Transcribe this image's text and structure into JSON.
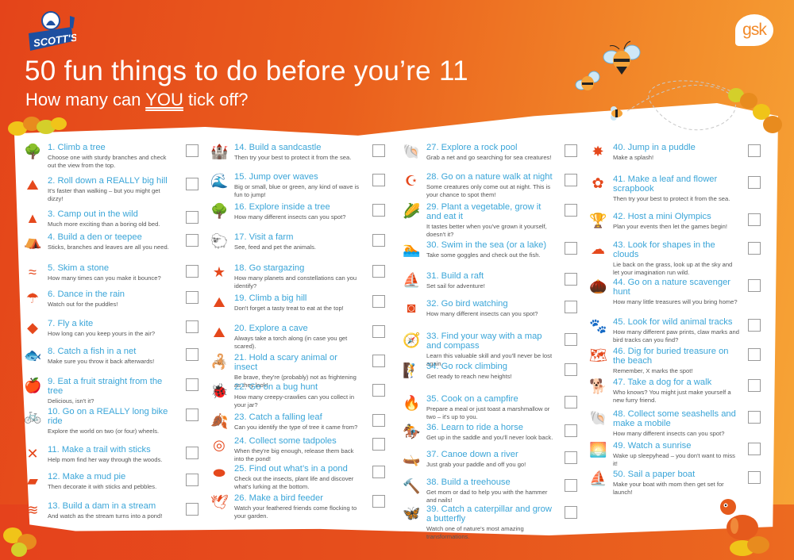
{
  "header": {
    "brand_left": "SCOTT'S",
    "brand_right": "gsk",
    "title": "50 fun things to do before you’re 11",
    "subtitle_pre": "How many can ",
    "subtitle_emph": "YOU",
    "subtitle_post": " tick off?"
  },
  "colors": {
    "background_orange": "#e95a1c",
    "accent_orange": "#e5481c",
    "item_title_blue": "#3aa5d8",
    "description_gray": "#555555",
    "checkbox_border": "#9a9a9a"
  },
  "columns": [
    {
      "items": [
        {
          "num": "1.",
          "title": "Climb a tree",
          "desc": "Choose one with sturdy branches and check out the view from the top.",
          "icon": "tree-climber-icon",
          "glyph": "🌳",
          "checked": false
        },
        {
          "num": "2.",
          "title": "Roll down a REALLY big hill",
          "desc": "It's faster than walking – but you might get dizzy!",
          "icon": "hill-roll-icon",
          "glyph": "⛰",
          "checked": false
        },
        {
          "num": "3.",
          "title": "Camp out in the wild",
          "desc": "Much more exciting than a boring old bed.",
          "icon": "tent-icon",
          "glyph": "▲",
          "checked": false
        },
        {
          "num": "4.",
          "title": "Build a den or teepee",
          "desc": "Sticks, branches and leaves are all you need.",
          "icon": "teepee-icon",
          "glyph": "⛺",
          "checked": false
        },
        {
          "num": "5.",
          "title": "Skim a stone",
          "desc": "How many times can you make it bounce?",
          "icon": "stone-skim-icon",
          "glyph": "≈",
          "checked": false
        },
        {
          "num": "6.",
          "title": "Dance in the rain",
          "desc": "Watch out for the puddles!",
          "icon": "rain-boot-icon",
          "glyph": "☂",
          "checked": false
        },
        {
          "num": "7.",
          "title": "Fly a kite",
          "desc": "How long can you keep yours in the air?",
          "icon": "kite-icon",
          "glyph": "◆",
          "checked": false
        },
        {
          "num": "8.",
          "title": "Catch a fish in a net",
          "desc": "Make sure you throw it back afterwards!",
          "icon": "fish-icon",
          "glyph": "🐟",
          "checked": false
        },
        {
          "num": "9.",
          "title": "Eat a fruit straight from the tree",
          "desc": "Delicious, isn't it?",
          "icon": "apple-icon",
          "glyph": "🍎",
          "checked": false
        },
        {
          "num": "10.",
          "title": "Go on a REALLY long bike ride",
          "desc": "Explore the world on two (or four) wheels.",
          "icon": "bicycle-icon",
          "glyph": "🚲",
          "checked": false
        },
        {
          "num": "11.",
          "title": "Make a trail with sticks",
          "desc": "Help mom find her way through the woods.",
          "icon": "crossed-sticks-icon",
          "glyph": "✕",
          "checked": false
        },
        {
          "num": "12.",
          "title": "Make a mud pie",
          "desc": "Then decorate it with sticks and pebbles.",
          "icon": "mud-pie-icon",
          "glyph": "▰",
          "checked": false
        },
        {
          "num": "13.",
          "title": "Build a dam in a stream",
          "desc": "And watch as the stream turns into a pond!",
          "icon": "dam-icon",
          "glyph": "≋",
          "checked": false
        }
      ]
    },
    {
      "items": [
        {
          "num": "14.",
          "title": "Build a sandcastle",
          "desc": "Then try your best to protect it from the sea.",
          "icon": "sandcastle-icon",
          "glyph": "🏰",
          "checked": false
        },
        {
          "num": "15.",
          "title": "Jump over waves",
          "desc": "Big or small, blue or green, any kind of wave is fun to jump!",
          "icon": "wave-icon",
          "glyph": "🌊",
          "checked": false
        },
        {
          "num": "16.",
          "title": "Explore inside a tree",
          "desc": "How many different insects can you spot?",
          "icon": "tree-icon",
          "glyph": "🌳",
          "checked": false
        },
        {
          "num": "17.",
          "title": "Visit a farm",
          "desc": "See, feed and pet the animals.",
          "icon": "sheep-icon",
          "glyph": "🐑",
          "checked": false
        },
        {
          "num": "18.",
          "title": "Go stargazing",
          "desc": "How many planets and constellations can you identify?",
          "icon": "stars-icon",
          "glyph": "★",
          "checked": false
        },
        {
          "num": "19.",
          "title": "Climb a big hill",
          "desc": "Don't forget a tasty treat to eat at the top!",
          "icon": "hill-icon",
          "glyph": "⛰",
          "checked": false
        },
        {
          "num": "20.",
          "title": "Explore a cave",
          "desc": "Always take a torch along (in case you get scared).",
          "icon": "cave-icon",
          "glyph": "⛰",
          "checked": false
        },
        {
          "num": "21.",
          "title": "Hold a scary animal or insect",
          "desc": "Be brave, they're (probably) not as frightening as they look!",
          "icon": "scorpion-icon",
          "glyph": "🦂",
          "checked": false
        },
        {
          "num": "22.",
          "title": "Go on a bug hunt",
          "desc": "How many creepy-crawlies can you collect in your jar?",
          "icon": "bug-icon",
          "glyph": "🐞",
          "checked": false
        },
        {
          "num": "23.",
          "title": "Catch a falling leaf",
          "desc": "Can you identify the type of tree it came from?",
          "icon": "hand-leaf-icon",
          "glyph": "🍂",
          "checked": false
        },
        {
          "num": "24.",
          "title": "Collect some tadpoles",
          "desc": "When they're big enough, release them back into the pond!",
          "icon": "tadpole-collector-icon",
          "glyph": "◎",
          "checked": false
        },
        {
          "num": "25.",
          "title": "Find out what’s in a pond",
          "desc": "Check out the insects, plant life and discover what's lurking at the bottom.",
          "icon": "pond-icon",
          "glyph": "⬬",
          "checked": false
        },
        {
          "num": "26.",
          "title": "Make a bird feeder",
          "desc": "Watch your feathered friends come flocking to your garden.",
          "icon": "bird-icon",
          "glyph": "🕊",
          "checked": false
        }
      ]
    },
    {
      "items": [
        {
          "num": "27.",
          "title": "Explore a rock pool",
          "desc": "Grab a net and go searching for sea creatures!",
          "icon": "seahorse-icon",
          "glyph": "🐚",
          "checked": false
        },
        {
          "num": "28.",
          "title": "Go on a nature walk at night",
          "desc": "Some creatures only come out at night. This is your chance to spot them!",
          "icon": "moon-star-icon",
          "glyph": "☪",
          "checked": false
        },
        {
          "num": "29.",
          "title": "Plant a vegetable, grow it and eat it",
          "desc": "It tastes better when you've grown it yourself, doesn't it?",
          "icon": "corn-icon",
          "glyph": "🌽",
          "checked": false
        },
        {
          "num": "30.",
          "title": "Swim in the sea (or a lake)",
          "desc": "Take some goggles and check out the fish.",
          "icon": "swimmer-icon",
          "glyph": "🏊",
          "checked": false
        },
        {
          "num": "31.",
          "title": "Build a raft",
          "desc": "Set sail for adventure!",
          "icon": "raft-icon",
          "glyph": "⛵",
          "checked": false
        },
        {
          "num": "32.",
          "title": "Go bird watching",
          "desc": "How many different insects can you spot?",
          "icon": "binoculars-icon",
          "glyph": "◙",
          "checked": false
        },
        {
          "num": "33.",
          "title": "Find your way with a map and compass",
          "desc": "Learn this valuable skill and you'll never be lost again.",
          "icon": "compass-icon",
          "glyph": "🧭",
          "checked": false
        },
        {
          "num": "34.",
          "title": "Go rock climbing",
          "desc": "Get ready to reach new heights!",
          "icon": "climber-icon",
          "glyph": "🧗",
          "checked": false
        },
        {
          "num": "35.",
          "title": "Cook on a campfire",
          "desc": "Prepare a meal or just toast a marshmallow or two – it's up to you.",
          "icon": "campfire-pan-icon",
          "glyph": "🔥",
          "checked": false
        },
        {
          "num": "36.",
          "title": "Learn to ride a horse",
          "desc": "Get up in the saddle and you'll never look back.",
          "icon": "horse-rider-icon",
          "glyph": "🏇",
          "checked": false
        },
        {
          "num": "37.",
          "title": "Canoe down a river",
          "desc": "Just grab your paddle and off you go!",
          "icon": "canoe-icon",
          "glyph": "🛶",
          "checked": false
        },
        {
          "num": "38.",
          "title": "Build a treehouse",
          "desc": "Get mom or dad to help you with the hammer and nails!",
          "icon": "hammer-icon",
          "glyph": "🔨",
          "checked": false
        },
        {
          "num": "39.",
          "title": "Catch a caterpillar and grow a butterfly",
          "desc": "Watch one of nature's most amazing transformations.",
          "icon": "butterfly-icon",
          "glyph": "🦋",
          "checked": false
        }
      ]
    },
    {
      "items": [
        {
          "num": "40.",
          "title": "Jump in a puddle",
          "desc": "Make a splash!",
          "icon": "splash-icon",
          "glyph": "✸",
          "checked": false
        },
        {
          "num": "41.",
          "title": "Make a leaf and flower scrapbook",
          "desc": "Then try your best to protect it from the sea.",
          "icon": "flower-icon",
          "glyph": "✿",
          "checked": false
        },
        {
          "num": "42.",
          "title": "Host a mini Olympics",
          "desc": "Plan your events then let the games begin!",
          "icon": "podium-icon",
          "glyph": "🏆",
          "checked": false
        },
        {
          "num": "43.",
          "title": "Look for shapes in the clouds",
          "desc": "Lie back on the grass, look up at the sky and let your imagination run wild.",
          "icon": "clouds-icon",
          "glyph": "☁",
          "checked": false
        },
        {
          "num": "44.",
          "title": "Go on a nature scavenger hunt",
          "desc": "How many little treasures will you bring home?",
          "icon": "acorn-icon",
          "glyph": "🌰",
          "checked": false
        },
        {
          "num": "45.",
          "title": "Look for wild animal tracks",
          "desc": "How many different paw prints, claw marks and bird tracks can you find?",
          "icon": "paw-prints-icon",
          "glyph": "🐾",
          "checked": false
        },
        {
          "num": "46.",
          "title": "Dig for buried treasure on the beach",
          "desc": "Remember, X marks the spot!",
          "icon": "treasure-map-icon",
          "glyph": "🗺",
          "checked": false
        },
        {
          "num": "47.",
          "title": "Take a dog for a walk",
          "desc": "Who knows? You might just make yourself a new furry friend.",
          "icon": "dog-icon",
          "glyph": "🐕",
          "checked": false
        },
        {
          "num": "48.",
          "title": "Collect some seashells and make a mobile",
          "desc": "How many different insects can you spot?",
          "icon": "seashell-icon",
          "glyph": "🐚",
          "checked": false
        },
        {
          "num": "49.",
          "title": "Watch a sunrise",
          "desc": "Wake up sleepyhead – you don't want to miss it!",
          "icon": "sunrise-icon",
          "glyph": "🌅",
          "checked": false
        },
        {
          "num": "50.",
          "title": "Sail a paper boat",
          "desc": "Make your boat with mom then get set for launch!",
          "icon": "paper-boat-icon",
          "glyph": "⛵",
          "checked": false
        }
      ]
    }
  ]
}
